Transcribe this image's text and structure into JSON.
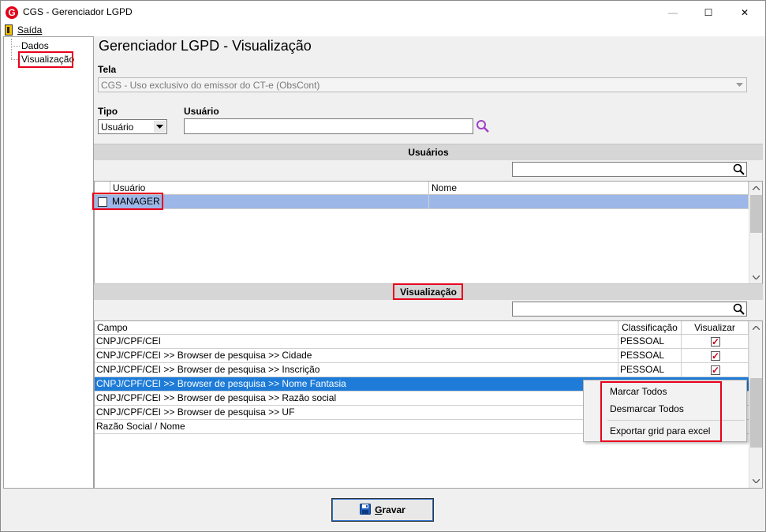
{
  "window": {
    "title": "CGS - Gerenciador LGPD",
    "logo_letter": "G",
    "minimize": "—",
    "maximize": "☐",
    "close": "✕"
  },
  "menu": {
    "exit_label": "Saída"
  },
  "tree": {
    "items": [
      {
        "label": "Dados"
      },
      {
        "label": "Visualização"
      }
    ]
  },
  "page": {
    "title": "Gerenciador LGPD - Visualização"
  },
  "tela": {
    "label": "Tela",
    "value": "CGS - Uso exclusivo do emissor do CT-e (ObsCont)"
  },
  "tipo": {
    "label": "Tipo",
    "value": "Usuário"
  },
  "usuario": {
    "label": "Usuário",
    "value": ""
  },
  "usuarios_section": {
    "title": "Usuários",
    "search_value": "",
    "columns": [
      "Usuário",
      "Nome"
    ],
    "rows": [
      {
        "usuario": "MANAGER",
        "nome": "",
        "checked": false
      }
    ]
  },
  "visualizacao_section": {
    "title": "Visualização",
    "search_value": "",
    "columns": [
      "Campo",
      "Classificação",
      "Visualizar"
    ],
    "rows": [
      {
        "campo": "CNPJ/CPF/CEI",
        "classificacao": "PESSOAL",
        "visualizar": true
      },
      {
        "campo": "CNPJ/CPF/CEI >> Browser de pesquisa >> Cidade",
        "classificacao": "PESSOAL",
        "visualizar": true
      },
      {
        "campo": "CNPJ/CPF/CEI >> Browser de pesquisa >> Inscrição",
        "classificacao": "PESSOAL",
        "visualizar": true
      },
      {
        "campo": "CNPJ/CPF/CEI >> Browser de pesquisa >> Nome Fantasia",
        "classificacao": "",
        "visualizar": null
      },
      {
        "campo": "CNPJ/CPF/CEI >> Browser de pesquisa >> Razão social",
        "classificacao": "",
        "visualizar": null
      },
      {
        "campo": "CNPJ/CPF/CEI >> Browser de pesquisa >> UF",
        "classificacao": "",
        "visualizar": null
      },
      {
        "campo": "Razão Social / Nome",
        "classificacao": "",
        "visualizar": null
      }
    ]
  },
  "context_menu": {
    "items": [
      "Marcar Todos",
      "Desmarcar Todos",
      "Exportar grid para excel"
    ]
  },
  "save_button": {
    "first_letter": "G",
    "rest": "ravar"
  },
  "colors": {
    "highlight_box": "#e8001c",
    "selected_row": "#1e7cd8",
    "user_row": "#9cb7e8",
    "search_icon": "#a040c8"
  }
}
